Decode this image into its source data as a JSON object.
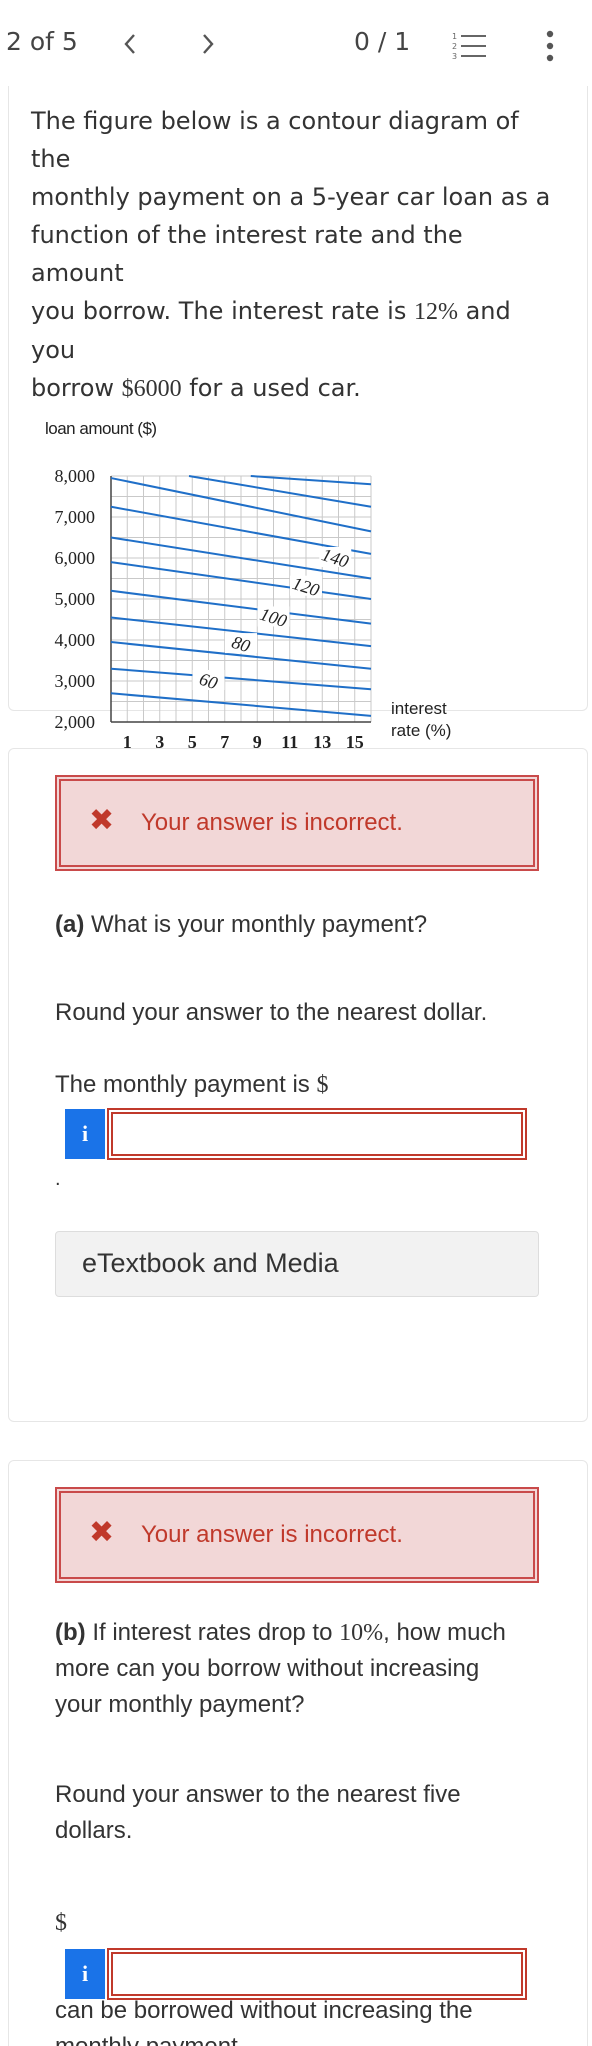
{
  "nav": {
    "counter": "2 of 5",
    "prev_icon": "chevron-left-icon",
    "next_icon": "chevron-right-icon",
    "score": "0 / 1",
    "list_icon": "numbered-list-icon",
    "menu_icon": "vertical-ellipsis-icon"
  },
  "intro": {
    "line1": "The figure below is a contour diagram of the",
    "line2": "monthly payment on a 5-year car loan as a",
    "line3": "function of the interest rate and the amount",
    "line4_pre": "you borrow. The interest rate is ",
    "rate": "12%",
    "line4_post": " and you",
    "line5_pre": "borrow ",
    "amount": "$6000",
    "line5_post": " for a used car."
  },
  "chart_data": {
    "type": "contour",
    "ylabel": "loan amount ($)",
    "xlabel_line1": "interest",
    "xlabel_line2": "rate (%)",
    "x_ticks": [
      "1",
      "3",
      "5",
      "7",
      "9",
      "11",
      "13",
      "15"
    ],
    "y_ticks": [
      "8,000",
      "7,000",
      "6,000",
      "5,000",
      "4,000",
      "3,000",
      "2,000"
    ],
    "xlim": [
      0,
      16
    ],
    "ylim": [
      2000,
      8000
    ],
    "contour_labels": [
      {
        "level": "60",
        "x": 6.0,
        "y": 3000
      },
      {
        "level": "80",
        "x": 8.0,
        "y": 3900
      },
      {
        "level": "100",
        "x": 10.0,
        "y": 4550
      },
      {
        "level": "120",
        "x": 12.0,
        "y": 5300
      },
      {
        "level": "140",
        "x": 13.8,
        "y": 6000
      }
    ],
    "contour_lines": [
      [
        [
          0,
          2700
        ],
        [
          16,
          2150
        ]
      ],
      [
        [
          0,
          3300
        ],
        [
          16,
          2800
        ]
      ],
      [
        [
          0,
          3950
        ],
        [
          16,
          3300
        ]
      ],
      [
        [
          0,
          4550
        ],
        [
          16,
          3850
        ]
      ],
      [
        [
          0,
          5200
        ],
        [
          16,
          4400
        ]
      ],
      [
        [
          0,
          5900
        ],
        [
          16,
          5000
        ]
      ],
      [
        [
          0,
          6500
        ],
        [
          16,
          5500
        ]
      ],
      [
        [
          0,
          7250
        ],
        [
          16,
          6100
        ]
      ],
      [
        [
          0,
          7950
        ],
        [
          16,
          6650
        ]
      ],
      [
        [
          4.8,
          8000
        ],
        [
          16,
          7250
        ]
      ],
      [
        [
          8.6,
          8000
        ],
        [
          16,
          7800
        ]
      ]
    ],
    "grid": true
  },
  "part_a": {
    "banner_msg": "Your answer is incorrect.",
    "label": "(a)",
    "question": " What is your monthly payment?",
    "round": "Round your answer to the nearest dollar.",
    "prompt_pre": "The monthly payment is ",
    "prompt_sign": "$",
    "info": "i",
    "answer_value": "",
    "period": ".",
    "etext": "eTextbook and Media"
  },
  "part_b": {
    "banner_msg": "Your answer is incorrect.",
    "label": "(b)",
    "q1_pre": " If interest rates drop to ",
    "rate": "10%",
    "q1_post": ", how much",
    "q2": "more can you borrow without increasing",
    "q3": "your monthly payment?",
    "round1": "Round your answer to the nearest five",
    "round2": "dollars.",
    "dollar": "$",
    "info": "i",
    "answer_value": "",
    "after1": "can be borrowed without increasing the",
    "after2": "monthly payment."
  },
  "colors": {
    "incorrect_red": "#c0392b",
    "banner_bg": "#f2d7d7",
    "info_blue": "#1a73e8",
    "contour_blue": "#1f6fc8"
  }
}
